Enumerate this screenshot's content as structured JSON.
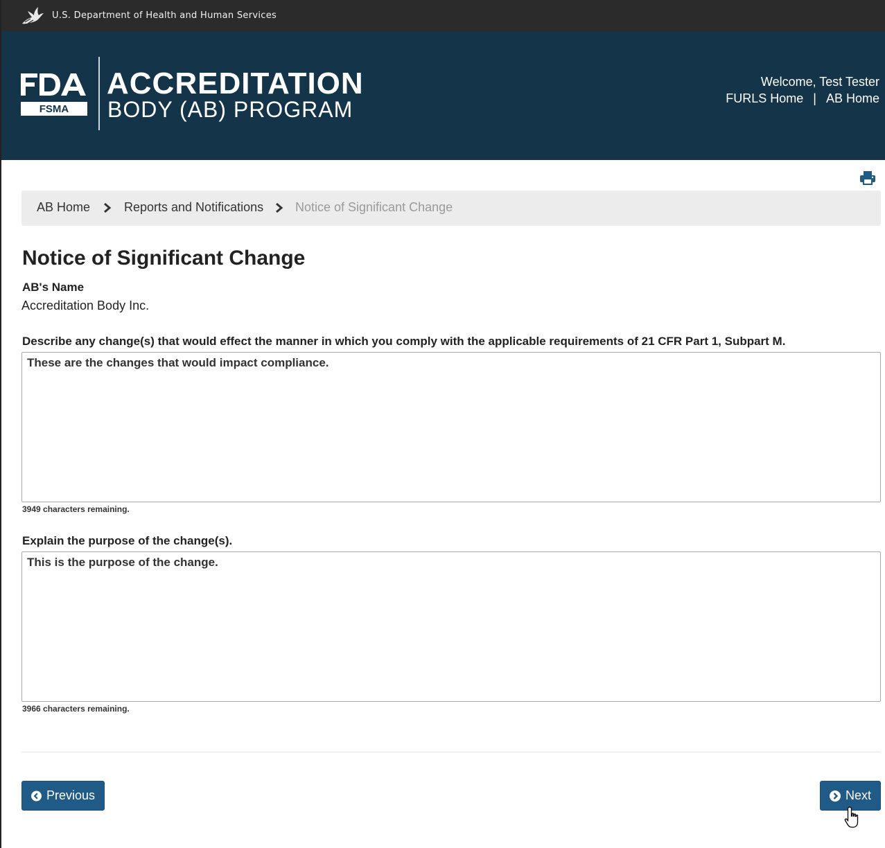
{
  "hhs_bar": {
    "text": "U.S. Department of Health and Human Services",
    "icon": "hhs-eagle-icon"
  },
  "banner": {
    "logo_text_top": "FDA",
    "logo_text_bottom": "FSMA",
    "title_line1": "ACCREDITATION",
    "title_line2": "BODY (AB) PROGRAM",
    "welcome": "Welcome, Test Tester",
    "links": [
      {
        "label": "FURLS Home"
      },
      {
        "label": "AB Home"
      }
    ],
    "separator": "|",
    "background_color": "#143449"
  },
  "toolbar": {
    "print_icon": "print-icon"
  },
  "breadcrumb": {
    "items": [
      {
        "label": "AB Home"
      },
      {
        "label": "Reports and Notifications"
      },
      {
        "label": "Notice of Significant Change"
      }
    ]
  },
  "main": {
    "title": "Notice of Significant Change",
    "ab_name_label": "AB's Name",
    "ab_name_value": "Accreditation Body Inc.",
    "questions": [
      {
        "label": "Describe any change(s) that would effect the manner in which you comply with the applicable requirements of 21 CFR Part 1, Subpart M.",
        "value": "These are the changes that would impact compliance.",
        "remaining": "3949 characters remaining."
      },
      {
        "label": "Explain the purpose of the change(s).",
        "value": "This is the purpose of the change.",
        "remaining": "3966 characters remaining."
      }
    ]
  },
  "footer_buttons": {
    "previous_label": "Previous",
    "next_label": "Next",
    "button_color": "#1f5b86"
  }
}
